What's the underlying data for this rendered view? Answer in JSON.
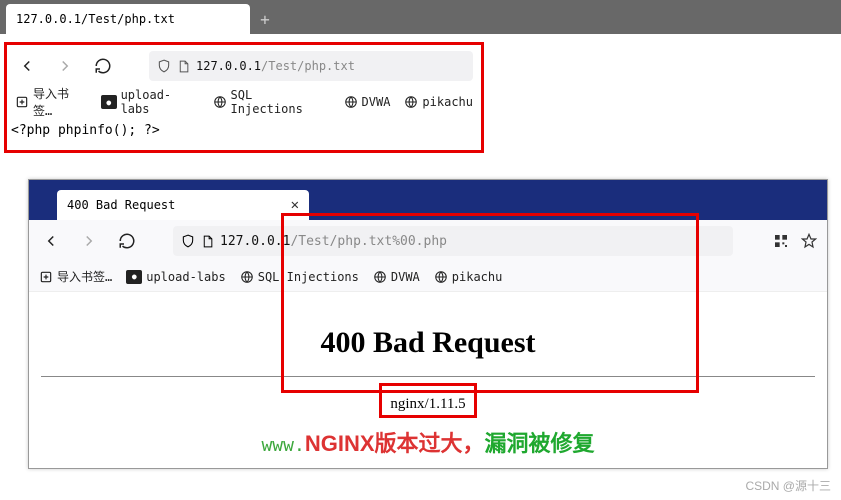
{
  "top": {
    "tab_title": "127.0.0.1/Test/php.txt",
    "url_host": "127.0.0.1",
    "url_path": "/Test/php.txt",
    "bookmarks": {
      "import": "导入书签…",
      "upload_labs": "upload-labs",
      "sql_injections": "SQL Injections",
      "dvwa": "DVWA",
      "pikachu": "pikachu"
    },
    "content": "<?php phpinfo(); ?>"
  },
  "bottom": {
    "tab_title": "400 Bad Request",
    "url_host": "127.0.0.1",
    "url_path": "/Test/php.txt%00.php",
    "bookmarks": {
      "import": "导入书签…",
      "upload_labs": "upload-labs",
      "sql_injections": "SQL Injections",
      "dvwa": "DVWA",
      "pikachu": "pikachu"
    },
    "heading": "400 Bad Request",
    "server": "nginx/1.11.5"
  },
  "annotation": {
    "www": "www.",
    "nginx_cn": "NGINX版本过大，",
    "fixed": "漏洞被修复"
  },
  "watermark": "CSDN @源十三"
}
